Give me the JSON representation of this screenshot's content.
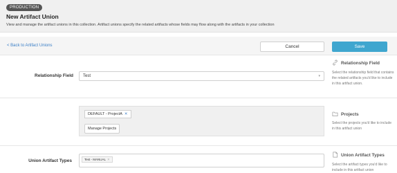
{
  "header": {
    "env_badge": "PRODUCTION",
    "title": "New Artifact Union",
    "description": "View and manage the artifact unions in this collection. Artifact unions specify the related artifacts whose fields may flow along with the artifacts in your collection"
  },
  "actionbar": {
    "back_label": "< Back to Artifact Unions",
    "cancel_label": "Cancel",
    "save_label": "Save"
  },
  "relationship": {
    "label": "Relationship Field",
    "value": "Test",
    "help_title": "Relationship Field",
    "help_text": "Select the relationship field that contains the related artifacts you'd like to include in this artifact union.",
    "icon": "link-icon"
  },
  "projects": {
    "tag_label": "DEFAULT - ProjectA",
    "manage_label": "Manage Projects",
    "help_title": "Projects",
    "help_text": "Select the projects you'd like to include in this artifact union",
    "icon": "folder-icon"
  },
  "types": {
    "label": "Union Artifact Types",
    "tag_label": "Test - MANUAL",
    "help_title": "Union Artifact Types",
    "help_text": "Select the artifact types you'd like to include in this artifact union",
    "icon": "document-icon"
  },
  "colors": {
    "accent": "#3fa6cf",
    "link": "#3a7ec6",
    "badge": "#555555"
  }
}
